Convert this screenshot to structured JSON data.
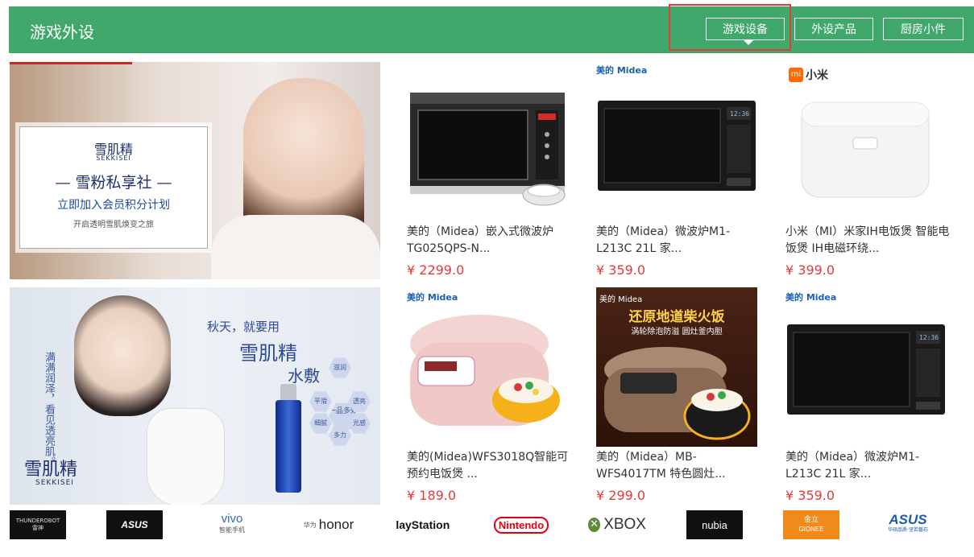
{
  "header": {
    "title": "游戏外设",
    "tabs": [
      {
        "label": "游戏设备"
      },
      {
        "label": "外设产品"
      },
      {
        "label": "厨房小件"
      }
    ]
  },
  "banners": [
    {
      "brand": "雪肌精",
      "brand_en": "SEKKISEI",
      "headline": "— 雪粉私享社 —",
      "subline": "立即加入会员积分计划",
      "small": "开启透明雪肌焕变之旅"
    },
    {
      "line1": "秋天，就要用",
      "line2": "雪肌精",
      "line3": "水敷",
      "side_text": "满满润泽，看见透亮肌。",
      "logo": "雪肌精",
      "logo_en": "SEKKISEI",
      "hex_labels": [
        "滋润",
        "平滑",
        "一品多效",
        "透亮",
        "细腻",
        "光感",
        "多力"
      ]
    }
  ],
  "products": [
    {
      "name": "美的（Midea）嵌入式微波炉 TG025QPS-N...",
      "price": "¥ 2299.0",
      "logo": ""
    },
    {
      "name": "美的（Midea）微波炉M1-L213C 21L 家...",
      "price": "¥ 359.0",
      "logo": "美的 Midea"
    },
    {
      "name": "小米（MI）米家IH电饭煲 智能电饭煲 IH电磁环绕...",
      "price": "¥ 399.0",
      "logo": "小米"
    },
    {
      "name": "美的(Midea)WFS3018Q智能可预约电饭煲 ...",
      "price": "¥ 189.0",
      "logo": "美的 Midea"
    },
    {
      "name": "美的（Midea）MB-WFS4017TM 特色圆灶...",
      "price": "¥ 299.0",
      "logo": "美的 Midea",
      "promo_title": "还原地道柴火饭",
      "promo_sub": "涡轮除泡防溢  圆灶釜内胆"
    },
    {
      "name": "美的（Midea）微波炉M1-L213C 21L 家...",
      "price": "¥ 359.0",
      "logo": "美的 Midea"
    }
  ],
  "brands": [
    {
      "name": "THUNDEROBOT",
      "label": "雷神"
    },
    {
      "name": "ASUS"
    },
    {
      "name": "vivo",
      "label": "智能手机"
    },
    {
      "name": "honor",
      "label": "华为"
    },
    {
      "name": "PlayStation"
    },
    {
      "name": "Nintendo"
    },
    {
      "name": "XBOX"
    },
    {
      "name": "nubia"
    },
    {
      "name": "GIONEE",
      "label": "金立"
    },
    {
      "name": "ASUS",
      "label": "华硕品质·坚若磐石"
    }
  ],
  "colors": {
    "header_green": "#3fa86a",
    "price_red": "#e4393c",
    "highlight_red": "#e53b3b"
  }
}
